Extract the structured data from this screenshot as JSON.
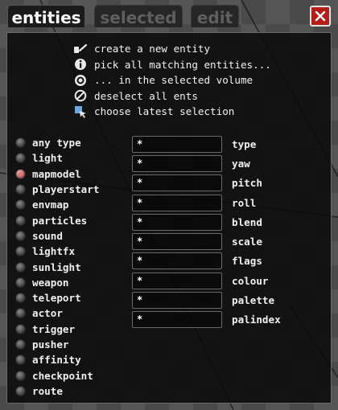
{
  "tabs": [
    {
      "label": "entities",
      "active": true
    },
    {
      "label": "selected",
      "active": false
    },
    {
      "label": "edit",
      "active": false
    }
  ],
  "close": {
    "icon": "close-x-icon",
    "color": "#b31e18"
  },
  "actions": [
    {
      "icon": "wand-icon",
      "label": "create a new entity"
    },
    {
      "icon": "info-icon",
      "label": "pick all matching entities..."
    },
    {
      "icon": "target-icon",
      "label": "... in the selected volume"
    },
    {
      "icon": "no-entry-icon",
      "label": "deselect all ents"
    },
    {
      "icon": "arrow-select-icon",
      "label": "choose latest selection"
    }
  ],
  "entity_types": [
    {
      "label": "any type",
      "selected": false
    },
    {
      "label": "light",
      "selected": false
    },
    {
      "label": "mapmodel",
      "selected": true
    },
    {
      "label": "playerstart",
      "selected": false
    },
    {
      "label": "envmap",
      "selected": false
    },
    {
      "label": "particles",
      "selected": false
    },
    {
      "label": "sound",
      "selected": false
    },
    {
      "label": "lightfx",
      "selected": false
    },
    {
      "label": "sunlight",
      "selected": false
    },
    {
      "label": "weapon",
      "selected": false
    },
    {
      "label": "teleport",
      "selected": false
    },
    {
      "label": "actor",
      "selected": false
    },
    {
      "label": "trigger",
      "selected": false
    },
    {
      "label": "pusher",
      "selected": false
    },
    {
      "label": "affinity",
      "selected": false
    },
    {
      "label": "checkpoint",
      "selected": false
    },
    {
      "label": "route",
      "selected": false
    }
  ],
  "fields": [
    {
      "value": "*",
      "label": "type"
    },
    {
      "value": "*",
      "label": "yaw"
    },
    {
      "value": "*",
      "label": "pitch"
    },
    {
      "value": "*",
      "label": "roll"
    },
    {
      "value": "*",
      "label": "blend"
    },
    {
      "value": "*",
      "label": "scale"
    },
    {
      "value": "*",
      "label": "flags"
    },
    {
      "value": "*",
      "label": "colour"
    },
    {
      "value": "*",
      "label": "palette"
    },
    {
      "value": "*",
      "label": "palindex"
    }
  ]
}
